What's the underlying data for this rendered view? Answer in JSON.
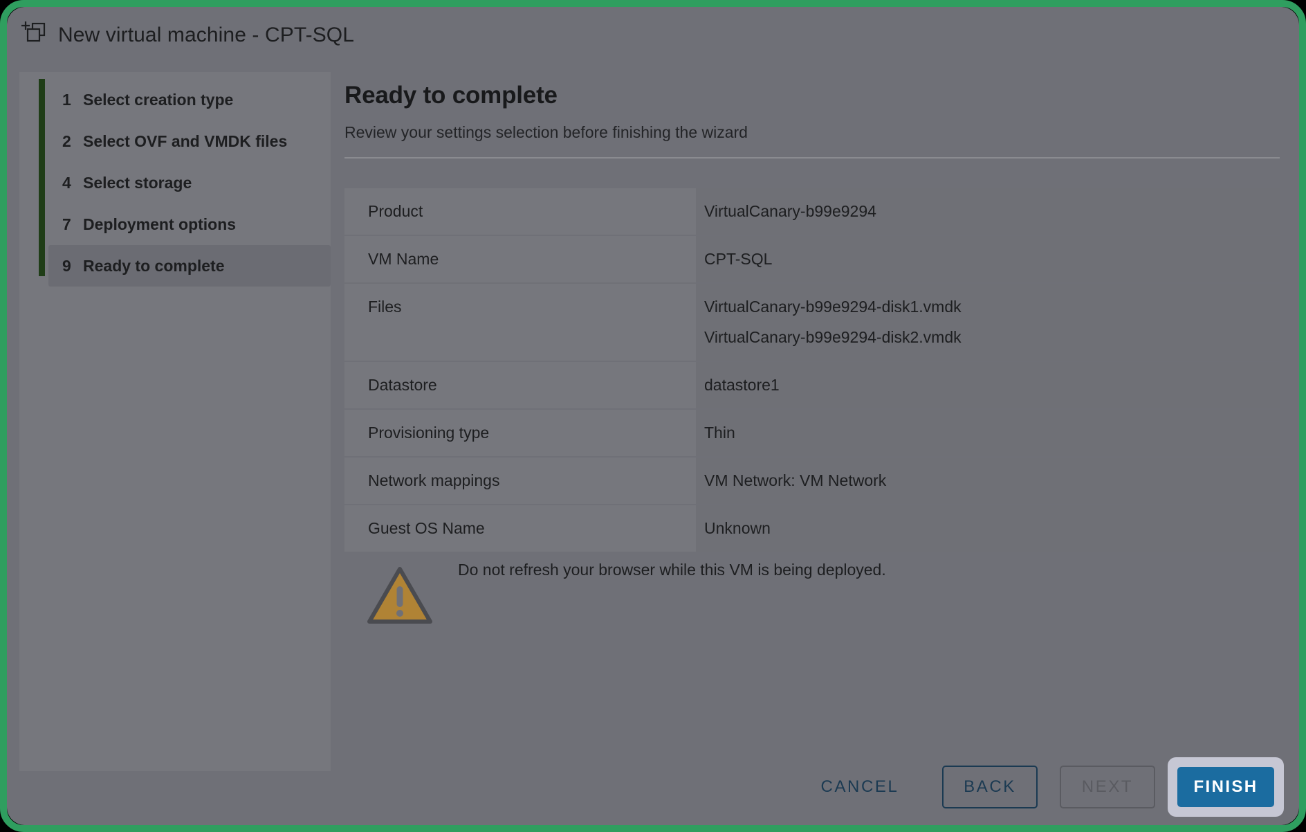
{
  "window": {
    "title": "New virtual machine - CPT-SQL",
    "icon": "new-vm-icon",
    "frame_accent_color": "#2f9e5f",
    "background_color": "#6f7077"
  },
  "sidebar": {
    "rail_color": "#1f3d17",
    "steps": [
      {
        "number": "1",
        "label": "Select creation type",
        "selected": false
      },
      {
        "number": "2",
        "label": "Select OVF and VMDK files",
        "selected": false
      },
      {
        "number": "4",
        "label": "Select storage",
        "selected": false
      },
      {
        "number": "7",
        "label": "Deployment options",
        "selected": false
      },
      {
        "number": "9",
        "label": "Ready to complete",
        "selected": true
      }
    ]
  },
  "content": {
    "title": "Ready to complete",
    "subtitle": "Review your settings selection before finishing the wizard",
    "summary": [
      {
        "key": "Product",
        "values": [
          "VirtualCanary-b99e9294"
        ]
      },
      {
        "key": "VM Name",
        "values": [
          "CPT-SQL"
        ]
      },
      {
        "key": "Files",
        "values": [
          "VirtualCanary-b99e9294-disk1.vmdk",
          "VirtualCanary-b99e9294-disk2.vmdk"
        ]
      },
      {
        "key": "Datastore",
        "values": [
          "datastore1"
        ]
      },
      {
        "key": "Provisioning type",
        "values": [
          "Thin"
        ]
      },
      {
        "key": "Network mappings",
        "values": [
          "VM Network: VM Network"
        ]
      },
      {
        "key": "Guest OS Name",
        "values": [
          "Unknown"
        ]
      }
    ],
    "warning": {
      "icon": "warning-triangle-icon",
      "icon_color": "#b08335",
      "text": "Do not refresh your browser while this VM is being deployed."
    }
  },
  "footer": {
    "cancel_label": "CANCEL",
    "back_label": "BACK",
    "next_label": "NEXT",
    "finish_label": "FINISH",
    "next_disabled": true,
    "finish_color": "#1b6ca0",
    "finish_focus_ring_color": "#c6c7d4"
  }
}
